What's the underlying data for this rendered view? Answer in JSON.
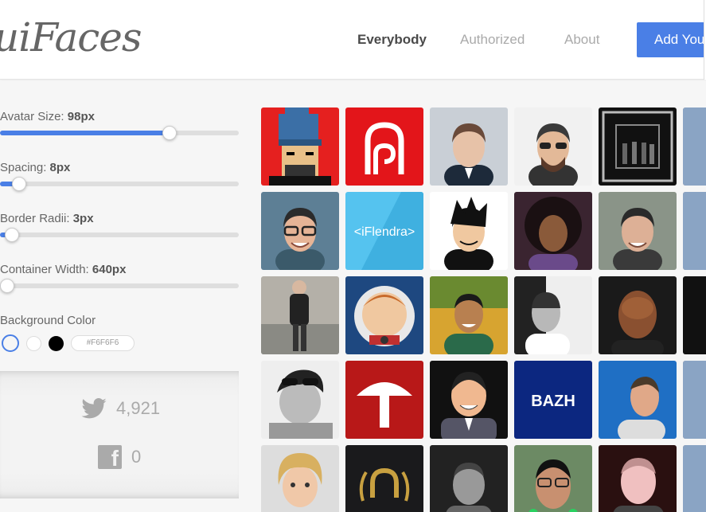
{
  "header": {
    "logo": "uiFaces",
    "nav": [
      {
        "label": "Everybody",
        "active": true
      },
      {
        "label": "Authorized",
        "active": false
      },
      {
        "label": "About",
        "active": false
      }
    ],
    "add_button": "Add Your"
  },
  "sidebar": {
    "avatar_size": {
      "label": "Avatar Size:",
      "value": "98px",
      "level": 0.71
    },
    "spacing": {
      "label": "Spacing:",
      "value": "8px",
      "level": 0.08
    },
    "border_radii": {
      "label": "Border Radii:",
      "value": "3px",
      "level": 0.05
    },
    "container_width": {
      "label": "Container Width:",
      "value": "640px",
      "level": 0.03
    },
    "background": {
      "label": "Background Color",
      "hex": "#F6F6F6"
    },
    "twitter_count": "4,921",
    "facebook_count": "0"
  },
  "colors": {
    "accent": "#4a7fe6",
    "background": "#f6f6f6"
  },
  "avatars": [
    {
      "kind": "pixel-beanie"
    },
    {
      "kind": "red-logo"
    },
    {
      "kind": "suit-man"
    },
    {
      "kind": "sunglasses-man"
    },
    {
      "kind": "band-box"
    },
    {
      "kind": "partial"
    },
    {
      "kind": "glasses-smile"
    },
    {
      "kind": "iflendra",
      "text": "<iFlendra>"
    },
    {
      "kind": "cartoon-man"
    },
    {
      "kind": "curly-hair"
    },
    {
      "kind": "smiling-man"
    },
    {
      "kind": "partial"
    },
    {
      "kind": "standing-man"
    },
    {
      "kind": "astronaut"
    },
    {
      "kind": "outdoor-man"
    },
    {
      "kind": "bw-man"
    },
    {
      "kind": "bald-man"
    },
    {
      "kind": "partial-dark"
    },
    {
      "kind": "bw-sunglasses"
    },
    {
      "kind": "red-arch"
    },
    {
      "kind": "cartoon-suit"
    },
    {
      "kind": "bazh",
      "text": "BAZH"
    },
    {
      "kind": "blue-profile"
    },
    {
      "kind": "partial"
    },
    {
      "kind": "blonde-woman"
    },
    {
      "kind": "gold-laurel"
    },
    {
      "kind": "dark-man"
    },
    {
      "kind": "green-man"
    },
    {
      "kind": "pink-man"
    },
    {
      "kind": "partial"
    }
  ]
}
